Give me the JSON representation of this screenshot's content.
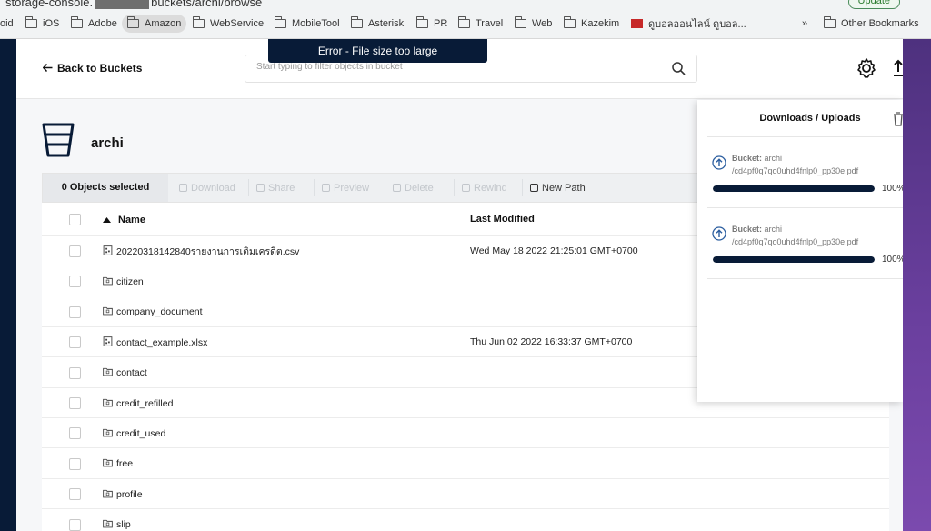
{
  "browser": {
    "url_prefix": "storage-console.",
    "url_suffix": "buckets/archi/browse",
    "update_label": "Update",
    "bookmarks": [
      "oid",
      "iOS",
      "Adobe",
      "Amazon",
      "WebService",
      "MobileTool",
      "Asterisk",
      "PR",
      "Travel",
      "Web",
      "Kazekim",
      "ดูบอลออนไลน์ ดูบอล...",
      "»",
      "Other Bookmarks"
    ]
  },
  "toast": {
    "message": "Error - File size too large"
  },
  "topbar": {
    "back_label": "Back to Buckets",
    "search_placeholder": "Start typing to filter objects in bucket"
  },
  "bucket": {
    "name": "archi"
  },
  "toolbar": {
    "selected_count": "0 Objects selected",
    "buttons": [
      "Download",
      "Share",
      "Preview",
      "Delete",
      "Rewind",
      "New Path"
    ]
  },
  "table": {
    "columns": [
      "Name",
      "Last Modified"
    ],
    "rows": [
      {
        "name": "20220318142840รายงานการเติมเครดิต.csv",
        "type": "file",
        "modified": "Wed May 18 2022 21:25:01 GMT+0700"
      },
      {
        "name": "citizen",
        "type": "folder",
        "modified": ""
      },
      {
        "name": "company_document",
        "type": "folder",
        "modified": ""
      },
      {
        "name": "contact_example.xlsx",
        "type": "file",
        "modified": "Thu Jun 02 2022 16:33:37 GMT+0700"
      },
      {
        "name": "contact",
        "type": "folder",
        "modified": ""
      },
      {
        "name": "credit_refilled",
        "type": "folder",
        "modified": ""
      },
      {
        "name": "credit_used",
        "type": "folder",
        "modified": ""
      },
      {
        "name": "free",
        "type": "folder",
        "modified": ""
      },
      {
        "name": "profile",
        "type": "folder",
        "modified": ""
      },
      {
        "name": "slip",
        "type": "folder",
        "modified": ""
      }
    ]
  },
  "panel": {
    "title": "Downloads / Uploads",
    "items": [
      {
        "bucket_label": "Bucket:",
        "bucket": "archi",
        "path": "/cd4pf0q7qo0uhd4fnlp0_pp30e.pdf",
        "progress": "100%",
        "progress_value": 1.0
      },
      {
        "bucket_label": "Bucket:",
        "bucket": "archi",
        "path": "/cd4pf0q7qo0uhd4fnlp0_pp30e.pdf",
        "progress": "100%",
        "progress_value": 1.0
      }
    ]
  },
  "colors": {
    "navy": "#081b37",
    "purple": "#5a3a8a"
  }
}
